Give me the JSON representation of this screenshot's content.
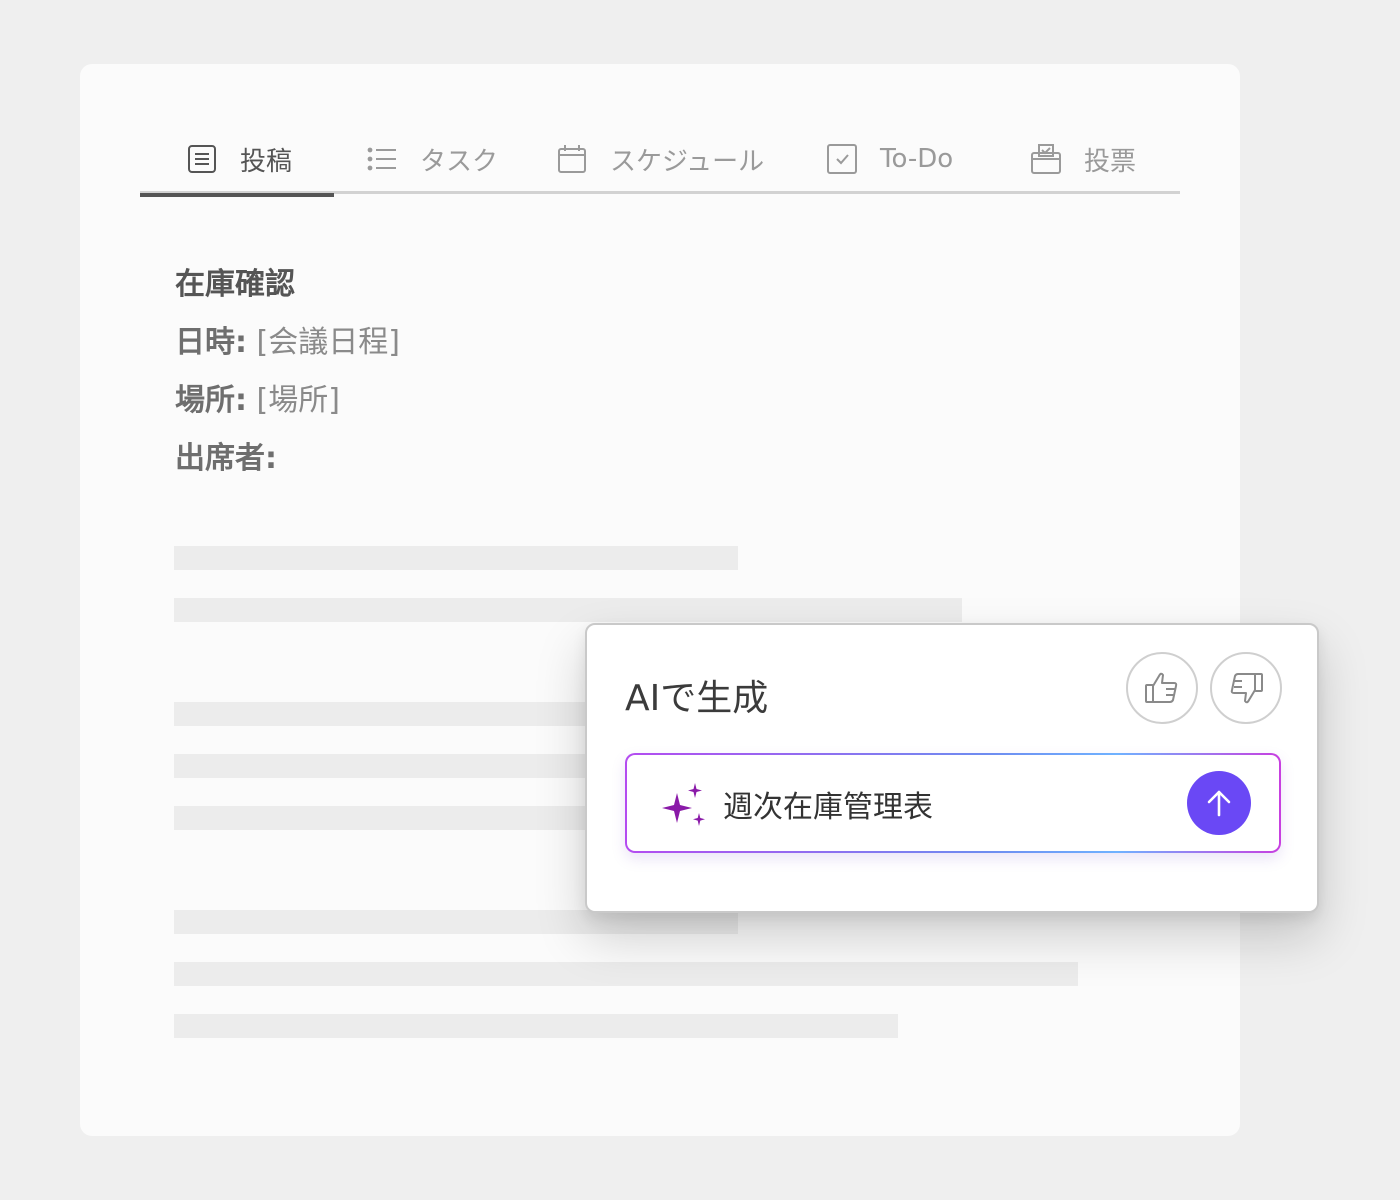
{
  "tabs": [
    {
      "label": "投稿",
      "icon": "post-icon",
      "active": true
    },
    {
      "label": "タスク",
      "icon": "task-list-icon",
      "active": false
    },
    {
      "label": "スケジュール",
      "icon": "calendar-icon",
      "active": false
    },
    {
      "label": "To-Do",
      "icon": "checkbox-icon",
      "active": false
    },
    {
      "label": "投票",
      "icon": "ballot-box-icon",
      "active": false
    }
  ],
  "document": {
    "title": "在庫確認",
    "fields": [
      {
        "key": "日時:",
        "value": "[会議日程]"
      },
      {
        "key": "場所:",
        "value": "[場所]"
      },
      {
        "key": "出席者:",
        "value": ""
      }
    ]
  },
  "ai_panel": {
    "title": "AIで生成",
    "like_icon": "thumbs-up-icon",
    "dislike_icon": "thumbs-down-icon",
    "prompt_value": "週次在庫管理表",
    "sparkle_icon": "sparkle-icon",
    "send_icon": "arrow-up-icon",
    "colors": {
      "send": "#6a48f5",
      "sparkle": "#8a1aa8",
      "border_start": "#b44cf0",
      "border_end": "#6fb2ff"
    }
  }
}
